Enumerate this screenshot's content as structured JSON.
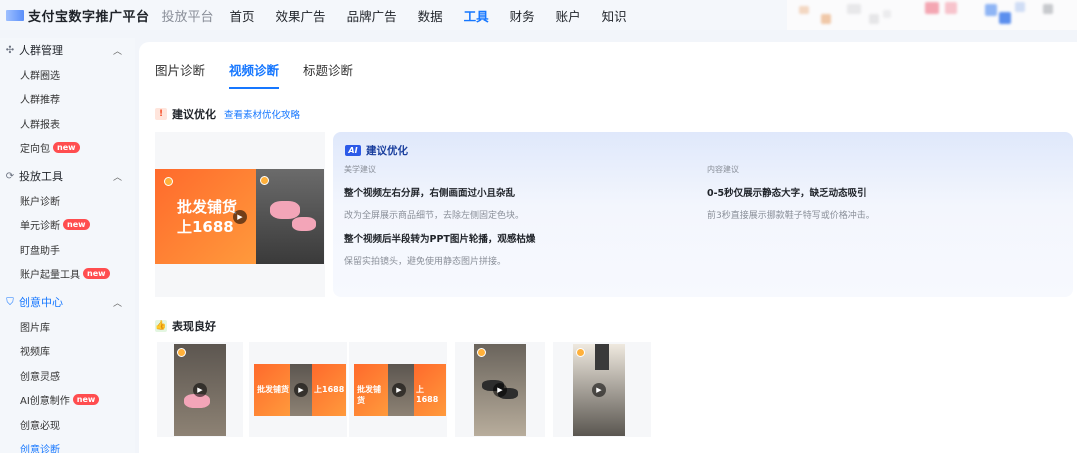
{
  "header": {
    "logo_text": "支付宝数字推广平台",
    "sub_title": "投放平台",
    "nav": [
      "首页",
      "效果广告",
      "品牌广告",
      "数据",
      "工具",
      "财务",
      "账户",
      "知识"
    ],
    "active_nav": "工具"
  },
  "sidebar": {
    "groups": [
      {
        "label": "人群管理",
        "icon": "crowd-icon",
        "items": [
          {
            "label": "人群圈选"
          },
          {
            "label": "人群推荐"
          },
          {
            "label": "人群报表"
          },
          {
            "label": "定向包",
            "badge": "new"
          }
        ]
      },
      {
        "label": "投放工具",
        "icon": "tools-icon",
        "items": [
          {
            "label": "账户诊断"
          },
          {
            "label": "单元诊断",
            "badge": "new"
          },
          {
            "label": "盯盘助手"
          },
          {
            "label": "账户起量工具",
            "badge": "new"
          }
        ]
      },
      {
        "label": "创意中心",
        "icon": "shield-icon",
        "items": [
          {
            "label": "图片库"
          },
          {
            "label": "视频库"
          },
          {
            "label": "创意灵感"
          },
          {
            "label": "AI创意制作",
            "badge": "new"
          },
          {
            "label": "创意必现"
          },
          {
            "label": "创意诊断"
          }
        ]
      }
    ]
  },
  "main": {
    "tabs": [
      "图片诊断",
      "视频诊断",
      "标题诊断"
    ],
    "active_tab": "视频诊断",
    "suggest": {
      "title": "建议优化",
      "link": "查看素材优化攻略",
      "thumb_text": [
        "批发铺货",
        "上1688"
      ],
      "card": {
        "badge": "AI",
        "title": "建议优化",
        "aesthetic": {
          "label": "美学建议",
          "points": [
            {
              "main": "整个视频左右分屏，右侧画面过小且杂乱",
              "sub": "改为全屏展示商品细节，去除左侧固定色块。"
            },
            {
              "main": "整个视频后半段转为PPT图片轮播，观感枯燥",
              "sub": "保留实拍镜头，避免使用静态图片拼接。"
            }
          ]
        },
        "content": {
          "label": "内容建议",
          "points": [
            {
              "main": "0-5秒仅展示静态大字，缺乏动态吸引",
              "sub": "前3秒直接展示挪款鞋子特写或价格冲击。"
            }
          ]
        }
      }
    },
    "good": {
      "title": "表现良好",
      "thumb_texts": [
        [
          "批发铺货",
          "上1688"
        ],
        [
          "批发铺货",
          "上1688"
        ]
      ]
    }
  }
}
